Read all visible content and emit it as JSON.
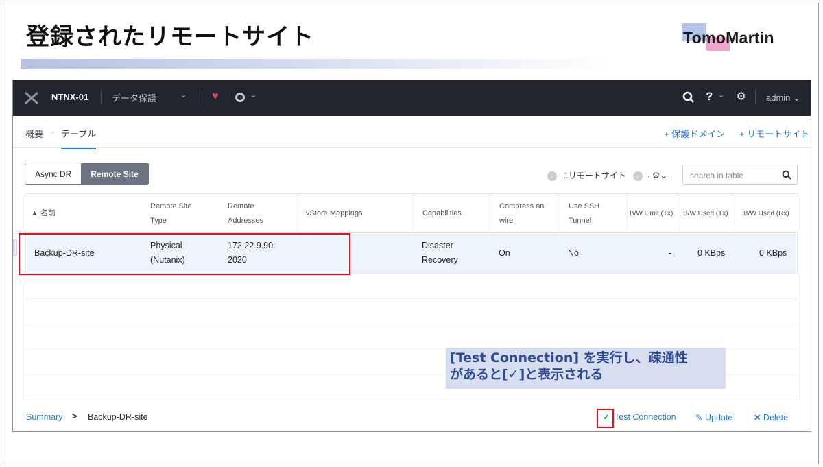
{
  "slide": {
    "title": "登録されたリモートサイト",
    "logo_text": "TomoMartin"
  },
  "topbar": {
    "cluster_name": "NTNX-01",
    "menu_label": "データ保護",
    "user": "admin",
    "help_glyph": "?",
    "icons": [
      "nutanix-x-icon",
      "health-heart-icon",
      "alerts-circle-icon",
      "search-icon",
      "help-icon",
      "gear-icon"
    ]
  },
  "subnav": {
    "overview": "概要",
    "separator": "·",
    "table_tab": "テーブル",
    "add_protection_domain": "+ 保護ドメイン",
    "add_remote_site": "+ リモートサイト"
  },
  "toggle": {
    "options": [
      "Async DR",
      "Remote Site"
    ],
    "selected": "Remote Site"
  },
  "pager": {
    "summary": "1リモートサイト",
    "search_placeholder": "search in table"
  },
  "table": {
    "columns": [
      {
        "l1": "▲ 名前",
        "l2": ""
      },
      {
        "l1": "Remote Site",
        "l2": "Type"
      },
      {
        "l1": "Remote",
        "l2": "Addresses"
      },
      {
        "l1": "vStore Mappings",
        "l2": ""
      },
      {
        "l1": "Capabilities",
        "l2": ""
      },
      {
        "l1": "Compress on",
        "l2": "wire"
      },
      {
        "l1": "Use SSH",
        "l2": "Tunnel"
      },
      {
        "l1": "B/W Limit (Tx)",
        "l2": ""
      },
      {
        "l1": "B/W Used (Tx)",
        "l2": ""
      },
      {
        "l1": "B/W Used (Rx)",
        "l2": ""
      }
    ],
    "rows": [
      {
        "name": "Backup-DR-site",
        "type_l1": "Physical",
        "type_l2": "(Nutanix)",
        "addr_l1": "172.22.9.90:",
        "addr_l2": "2020",
        "vstore": "",
        "cap_l1": "Disaster",
        "cap_l2": "Recovery",
        "compress": "On",
        "ssh": "No",
        "bw_limit_tx": "-",
        "bw_used_tx": "0 KBps",
        "bw_used_rx": "0 KBps"
      }
    ]
  },
  "callout": {
    "line1": "[Test Connection] を実行し、疎通性",
    "line2": "があると[✓]と表示される"
  },
  "footer": {
    "breadcrumb_link": "Summary",
    "breadcrumb_arrow": ">",
    "breadcrumb_current": "Backup-DR-site",
    "test_check": "✓",
    "test_connection": "Test Connection",
    "update": "Update",
    "delete": "Delete"
  },
  "colors": {
    "topbar_bg": "#22252d",
    "link_blue": "#1f7fd6",
    "highlight_red": "#e8101c",
    "callout_bg": "#d6def0",
    "callout_text": "#2e4a91",
    "selected_row_bg": "#eef4fb"
  }
}
